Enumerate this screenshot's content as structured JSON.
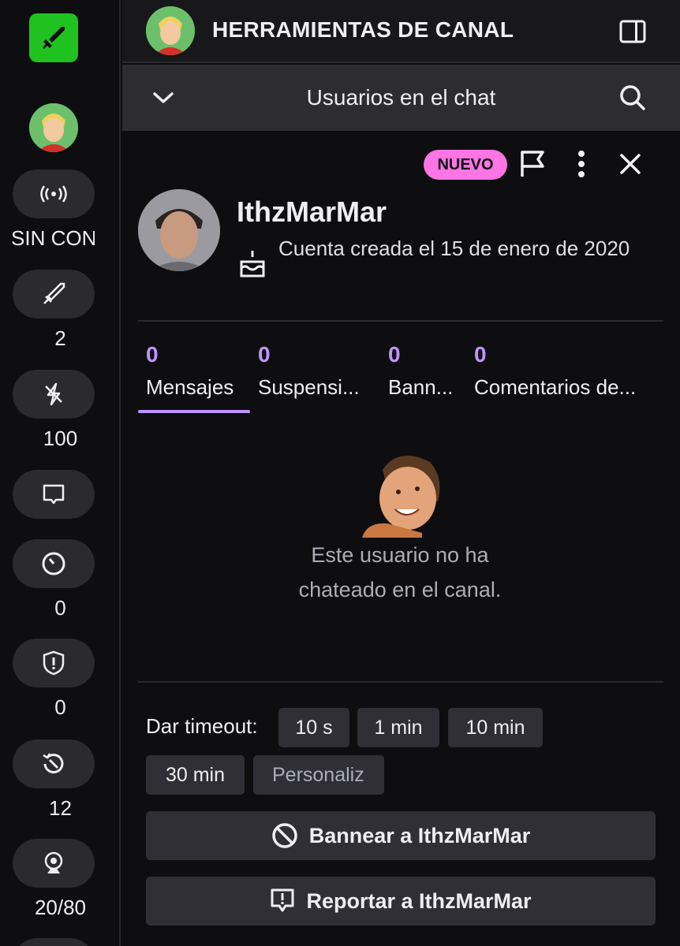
{
  "rail": {
    "status_label": "SIN CONEXIÓN",
    "mod_count": "2",
    "points": "100",
    "timer_count": "0",
    "shield_count": "0",
    "history_count": "12",
    "slots": "20/80"
  },
  "header": {
    "title": "HERRAMIENTAS DE CANAL"
  },
  "subheader": {
    "title": "Usuarios en el chat"
  },
  "card": {
    "badge": "NUEVO",
    "username": "IthzMarMar",
    "created": "Cuenta creada el 15 de enero de 2020",
    "tabs": [
      {
        "count": "0",
        "label": "Mensajes"
      },
      {
        "count": "0",
        "label": "Suspensi..."
      },
      {
        "count": "0",
        "label": "Bann..."
      },
      {
        "count": "0",
        "label": "Comentarios de..."
      }
    ],
    "empty_line1": "Este usuario no ha",
    "empty_line2": "chateado en el canal.",
    "timeout_label": "Dar timeout:",
    "timeouts": [
      "10 s",
      "1 min",
      "10 min",
      "30 min"
    ],
    "custom_placeholder": "Personaliz",
    "ban_label": "Bannear a IthzMarMar",
    "report_label": "Reportar a IthzMarMar"
  },
  "colors": {
    "accent": "#bf94ff",
    "badge": "#ff75e6",
    "logo": "#1fc21f"
  }
}
